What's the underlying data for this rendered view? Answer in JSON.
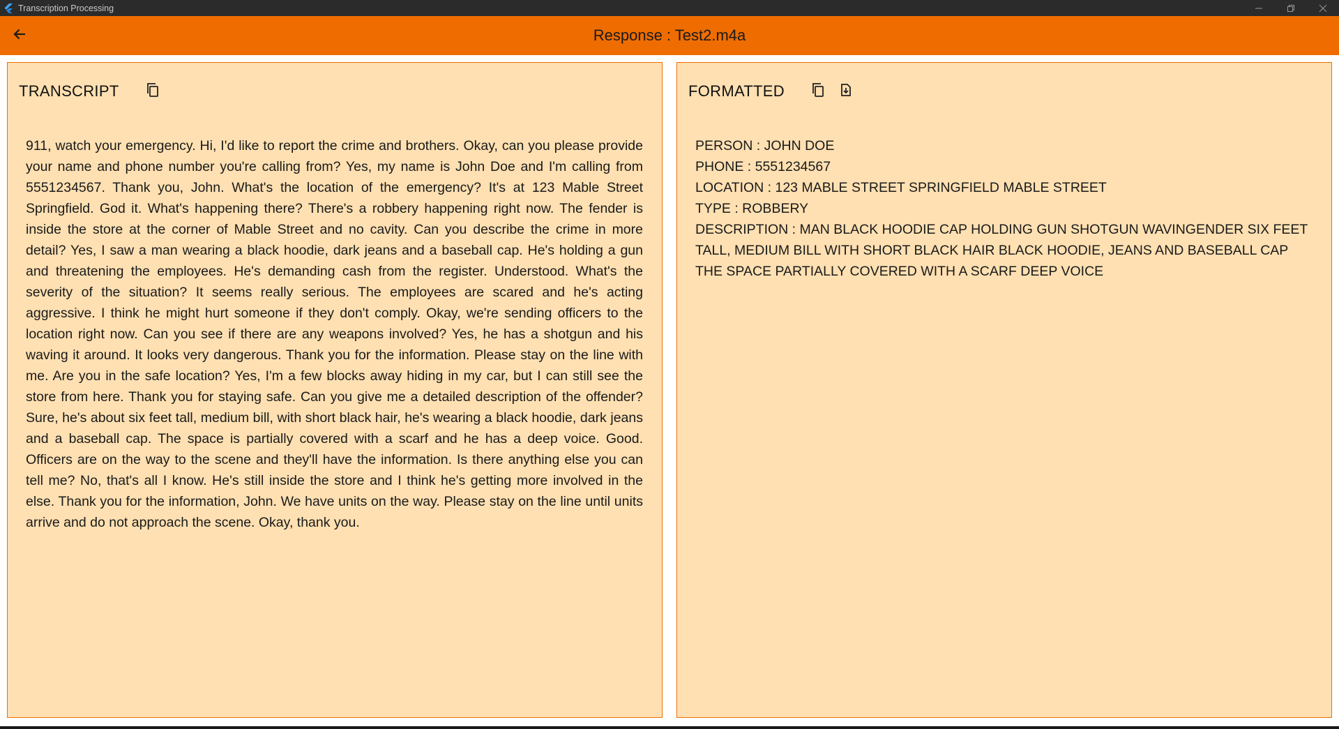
{
  "window": {
    "title": "Transcription Processing"
  },
  "appbar": {
    "title": "Response : Test2.m4a"
  },
  "transcript_panel": {
    "title": "TRANSCRIPT",
    "text": "911, watch your emergency. Hi, I'd like to report the crime and brothers. Okay, can you please provide your name and phone number you're calling from? Yes, my name is John Doe and I'm calling from 5551234567. Thank you, John. What's the location of the emergency? It's at 123 Mable Street Springfield. God it. What's happening there? There's a robbery happening right now. The fender is inside the store at the corner of Mable Street and no cavity. Can you describe the crime in more detail? Yes, I saw a man wearing a black hoodie, dark jeans and a baseball cap. He's holding a gun and threatening the employees. He's demanding cash from the register. Understood. What's the severity of the situation? It seems really serious. The employees are scared and he's acting aggressive. I think he might hurt someone if they don't comply. Okay, we're sending officers to the location right now. Can you see if there are any weapons involved? Yes, he has a shotgun and his waving it around. It looks very dangerous. Thank you for the information. Please stay on the line with me. Are you in the safe location? Yes, I'm a few blocks away hiding in my car, but I can still see the store from here. Thank you for staying safe. Can you give me a detailed description of the offender? Sure, he's about six feet tall, medium bill, with short black hair, he's wearing a black hoodie, dark jeans and a baseball cap. The space is partially covered with a scarf and he has a deep voice. Good. Officers are on the way to the scene and they'll have the information. Is there anything else you can tell me? No, that's all I know. He's still inside the store and I think he's getting more involved in the else. Thank you for the information, John. We have units on the way. Please stay on the line until units arrive and do not approach the scene. Okay, thank you."
  },
  "formatted_panel": {
    "title": "FORMATTED",
    "lines": [
      "PERSON : JOHN DOE",
      "PHONE : 5551234567",
      "LOCATION : 123 MABLE STREET SPRINGFIELD MABLE STREET",
      "TYPE : ROBBERY",
      "DESCRIPTION : MAN BLACK HOODIE CAP HOLDING GUN SHOTGUN WAVINGENDER SIX FEET TALL, MEDIUM BILL WITH SHORT BLACK HAIR BLACK HOODIE, JEANS AND BASEBALL CAP THE SPACE PARTIALLY COVERED WITH A SCARF DEEP VOICE"
    ]
  },
  "icons": {
    "app": "flutter-logo-icon",
    "back": "arrow-left-icon",
    "copy": "copy-icon",
    "save": "file-download-icon",
    "minimize": "minimize-icon",
    "maximize": "restore-icon",
    "close": "close-icon"
  },
  "colors": {
    "titlebar": "#2b2b2b",
    "appbar": "#ef6c00",
    "panel_bg": "#ffe0b2",
    "panel_border": "#ef6c00"
  }
}
